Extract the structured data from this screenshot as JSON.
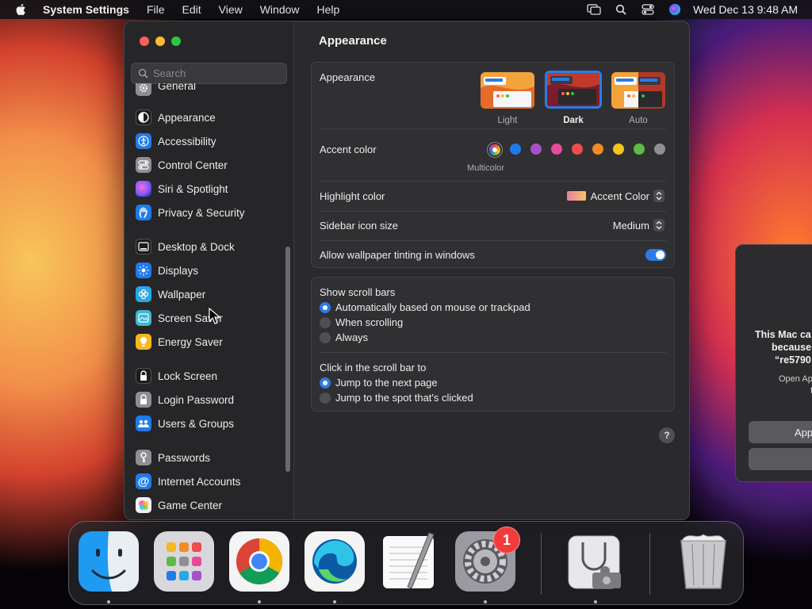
{
  "menubar": {
    "app_name": "System Settings",
    "menus": [
      "File",
      "Edit",
      "View",
      "Window",
      "Help"
    ],
    "clock": "Wed Dec 13  9:48 AM"
  },
  "sidebar": {
    "search_placeholder": "Search",
    "items": [
      {
        "label": "General",
        "icon": "gear-icon",
        "color": "#8e8e93"
      },
      {
        "label": "Appearance",
        "icon": "appearance-icon",
        "color": "#1c1c1e"
      },
      {
        "label": "Accessibility",
        "icon": "accessibility-icon",
        "color": "#1f7aeb"
      },
      {
        "label": "Control Center",
        "icon": "control-center-icon",
        "color": "#8e8e93"
      },
      {
        "label": "Siri & Spotlight",
        "icon": "siri-icon",
        "color": "#c23fd1"
      },
      {
        "label": "Privacy & Security",
        "icon": "hand-icon",
        "color": "#1f7aeb"
      },
      {
        "label": "Desktop & Dock",
        "icon": "dock-icon",
        "color": "#1c1c1e"
      },
      {
        "label": "Displays",
        "icon": "display-icon",
        "color": "#1f7aeb"
      },
      {
        "label": "Wallpaper",
        "icon": "wallpaper-icon",
        "color": "#27a9e8"
      },
      {
        "label": "Screen Saver",
        "icon": "screen-saver-icon",
        "color": "#3cb7d6"
      },
      {
        "label": "Energy Saver",
        "icon": "lightbulb-icon",
        "color": "#f5b820"
      },
      {
        "label": "Lock Screen",
        "icon": "lock-icon",
        "color": "#1c1c1e"
      },
      {
        "label": "Login Password",
        "icon": "padlock-icon",
        "color": "#8e8e93"
      },
      {
        "label": "Users & Groups",
        "icon": "users-icon",
        "color": "#1f7aeb"
      },
      {
        "label": "Passwords",
        "icon": "key-icon",
        "color": "#8e8e93"
      },
      {
        "label": "Internet Accounts",
        "icon": "at-icon",
        "color": "#1f7aeb"
      },
      {
        "label": "Game Center",
        "icon": "game-center-icon",
        "color": "#f0f0f0"
      }
    ]
  },
  "content": {
    "title": "Appearance",
    "appearance": {
      "label": "Appearance",
      "options": [
        "Light",
        "Dark",
        "Auto"
      ],
      "selected": "Dark"
    },
    "accent": {
      "label": "Accent color",
      "selected_name": "Multicolor",
      "colors": [
        "multicolor",
        "#1f7aeb",
        "#a650c9",
        "#e84a9a",
        "#ef4c4c",
        "#f28a25",
        "#f5c51c",
        "#5dbb48",
        "#8e8e93"
      ]
    },
    "highlight": {
      "label": "Highlight color",
      "value": "Accent Color"
    },
    "sidebar_icon_size": {
      "label": "Sidebar icon size",
      "value": "Medium"
    },
    "wallpaper_tinting": {
      "label": "Allow wallpaper tinting in windows",
      "on": true
    },
    "scroll_bars": {
      "label": "Show scroll bars",
      "options": [
        "Automatically based on mouse or trackpad",
        "When scrolling",
        "Always"
      ],
      "selected": 0
    },
    "click_scroll": {
      "label": "Click in the scroll bar to",
      "options": [
        "Jump to the next page",
        "Jump to the spot that's clicked"
      ],
      "selected": 0
    },
    "help": "?"
  },
  "alert": {
    "title_lines": [
      "This Mac ca",
      "because",
      "“re5790"
    ],
    "subtitle_lines": [
      "Open Ap",
      "f"
    ],
    "button1": "App"
  },
  "dock": {
    "apps": [
      "Finder",
      "Launchpad",
      "Google Chrome",
      "Microsoft Edge",
      "TextEdit",
      "System Settings",
      "Disk Utility",
      "Trash"
    ],
    "badge": "1"
  }
}
